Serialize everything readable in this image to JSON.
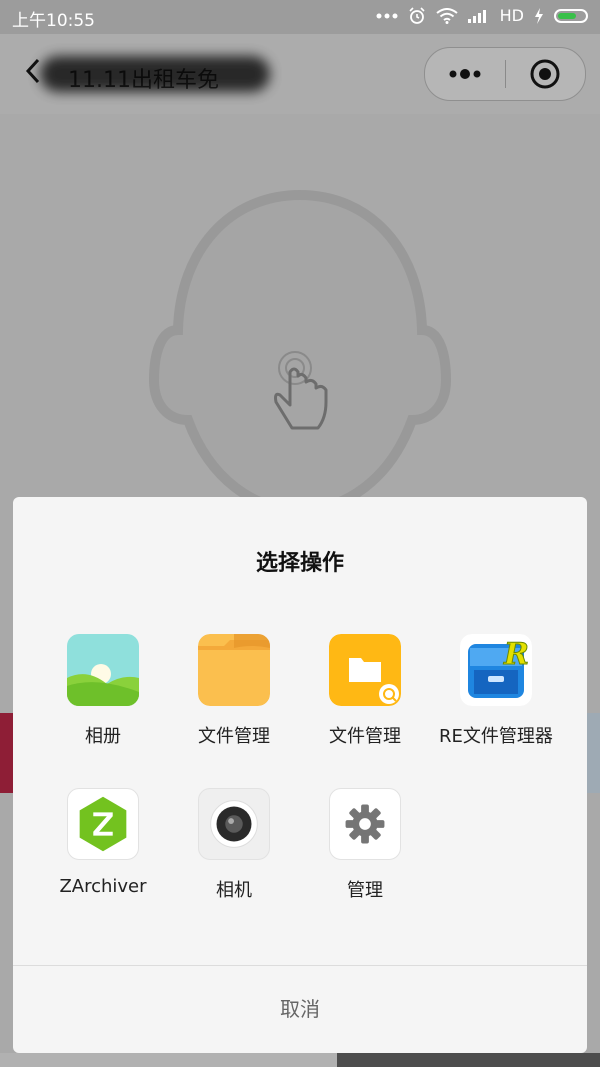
{
  "status_bar": {
    "time": "上午10:55",
    "network": "HD",
    "battery_color": "#39c04a"
  },
  "header": {
    "title": "11.11出租车免"
  },
  "dialog": {
    "title": "选择操作",
    "apps": [
      {
        "label": "相册",
        "icon": "photos-icon"
      },
      {
        "label": "文件管理",
        "icon": "folder-icon"
      },
      {
        "label": "文件管理",
        "icon": "file-manager-icon"
      },
      {
        "label": "RE文件管理器",
        "icon": "re-file-manager-icon"
      },
      {
        "label": "ZArchiver",
        "icon": "zarchiver-icon"
      },
      {
        "label": "相机",
        "icon": "camera-icon"
      },
      {
        "label": "管理",
        "icon": "gear-icon"
      }
    ],
    "cancel_label": "取消"
  }
}
